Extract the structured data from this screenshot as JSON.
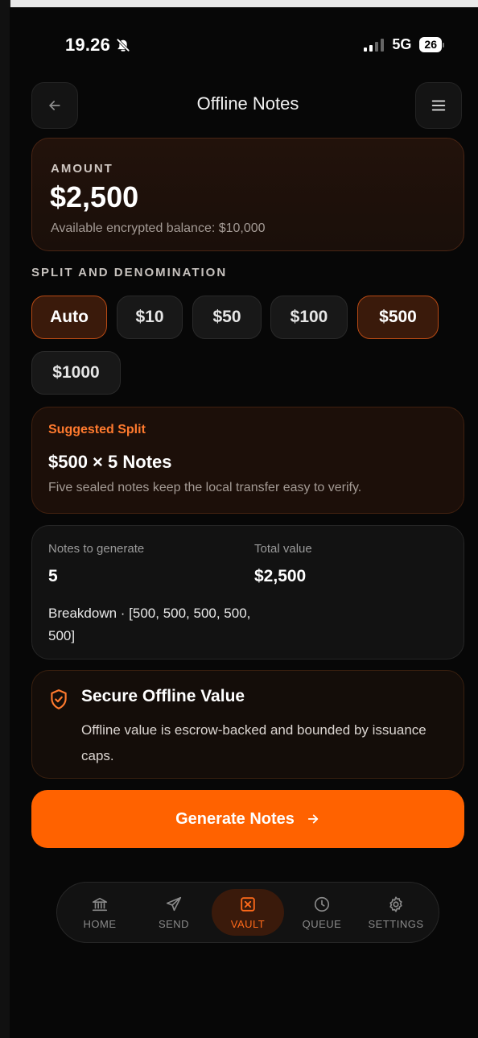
{
  "status": {
    "time": "19.26",
    "network": "5G",
    "battery": "26"
  },
  "header": {
    "title": "Offline Notes"
  },
  "amount": {
    "label": "AMOUNT",
    "value": "$2,500",
    "balance_text": "Available encrypted balance: $10,000"
  },
  "split": {
    "label": "SPLIT AND DENOMINATION",
    "chips": [
      {
        "label": "Auto",
        "active": true
      },
      {
        "label": "$10",
        "active": false
      },
      {
        "label": "$50",
        "active": false
      },
      {
        "label": "$100",
        "active": false
      },
      {
        "label": "$500",
        "active": true
      },
      {
        "label": "$1000",
        "active": false
      }
    ]
  },
  "suggested": {
    "label": "Suggested Split",
    "title": "$500 × 5 Notes",
    "description": "Five sealed notes keep the local transfer easy to verify."
  },
  "notes": {
    "count_label": "Notes to generate",
    "count_value": "5",
    "total_label": "Total value",
    "total_value": "$2,500",
    "breakdown": "Breakdown · [500, 500, 500, 500, 500]"
  },
  "secure": {
    "title": "Secure Offline Value",
    "description": "Offline value is escrow-backed and bounded by issuance caps."
  },
  "generate": {
    "label": "Generate Notes"
  },
  "nav": {
    "items": [
      {
        "label": "HOME",
        "icon": "bank-icon",
        "active": false
      },
      {
        "label": "SEND",
        "icon": "send-icon",
        "active": false
      },
      {
        "label": "VAULT",
        "icon": "vault-icon",
        "active": true
      },
      {
        "label": "QUEUE",
        "icon": "clock-icon",
        "active": false
      },
      {
        "label": "SETTINGS",
        "icon": "gear-icon",
        "active": false
      }
    ]
  },
  "colors": {
    "accent": "#ff6200",
    "accent_text": "#ff7a2e",
    "background": "#070707"
  }
}
